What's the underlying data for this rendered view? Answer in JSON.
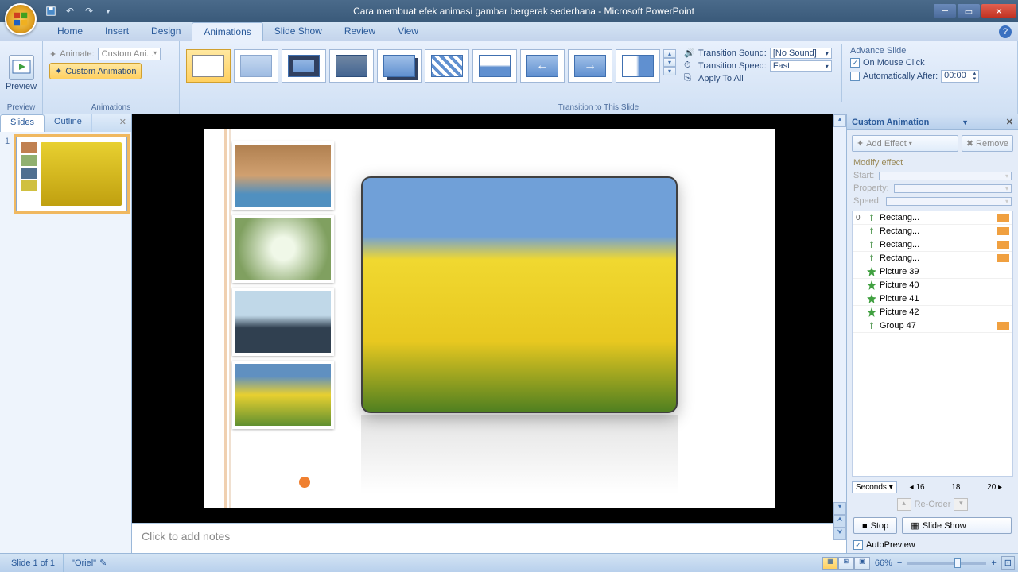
{
  "titlebar": {
    "title": "Cara membuat efek animasi gambar bergerak sederhana - Microsoft PowerPoint"
  },
  "tabs": {
    "items": [
      "Home",
      "Insert",
      "Design",
      "Animations",
      "Slide Show",
      "Review",
      "View"
    ],
    "active": 3
  },
  "ribbon": {
    "preview": {
      "label": "Preview",
      "group": "Preview"
    },
    "animations": {
      "animate_label": "Animate:",
      "animate_value": "Custom Ani...",
      "custom_btn": "Custom Animation",
      "group": "Animations"
    },
    "transition": {
      "sound_label": "Transition Sound:",
      "sound_value": "[No Sound]",
      "speed_label": "Transition Speed:",
      "speed_value": "Fast",
      "apply_all": "Apply To All",
      "group": "Transition to This Slide"
    },
    "advance": {
      "heading": "Advance Slide",
      "on_click": "On Mouse Click",
      "auto_after": "Automatically After:",
      "auto_value": "00:00"
    }
  },
  "leftpanel": {
    "tabs": {
      "slides": "Slides",
      "outline": "Outline"
    },
    "slide_num": "1"
  },
  "notes": {
    "placeholder": "Click to add notes"
  },
  "rightpanel": {
    "title": "Custom Animation",
    "add_effect": "Add Effect",
    "remove": "Remove",
    "modify": "Modify effect",
    "start": "Start:",
    "property": "Property:",
    "speed": "Speed:",
    "items": [
      {
        "seq": "0",
        "icon": "pin",
        "label": "Rectang...",
        "swatch": true
      },
      {
        "seq": "",
        "icon": "pin",
        "label": "Rectang...",
        "swatch": true
      },
      {
        "seq": "",
        "icon": "pin",
        "label": "Rectang...",
        "swatch": true
      },
      {
        "seq": "",
        "icon": "pin",
        "label": "Rectang...",
        "swatch": true
      },
      {
        "seq": "",
        "icon": "star-g",
        "label": "Picture 39",
        "swatch": false
      },
      {
        "seq": "",
        "icon": "star-g",
        "label": "Picture 40",
        "swatch": false
      },
      {
        "seq": "",
        "icon": "star-g",
        "label": "Picture 41",
        "swatch": false
      },
      {
        "seq": "",
        "icon": "star-g",
        "label": "Picture 42",
        "swatch": false
      },
      {
        "seq": "",
        "icon": "pin",
        "label": "Group 47",
        "swatch": true
      }
    ],
    "timeline": {
      "unit": "Seconds",
      "t1": "16",
      "t2": "18",
      "t3": "20"
    },
    "reorder": "Re-Order",
    "stop": "Stop",
    "slideshow": "Slide Show",
    "autopreview": "AutoPreview"
  },
  "statusbar": {
    "slide": "Slide 1 of 1",
    "theme": "\"Oriel\"",
    "zoom": "66%"
  }
}
